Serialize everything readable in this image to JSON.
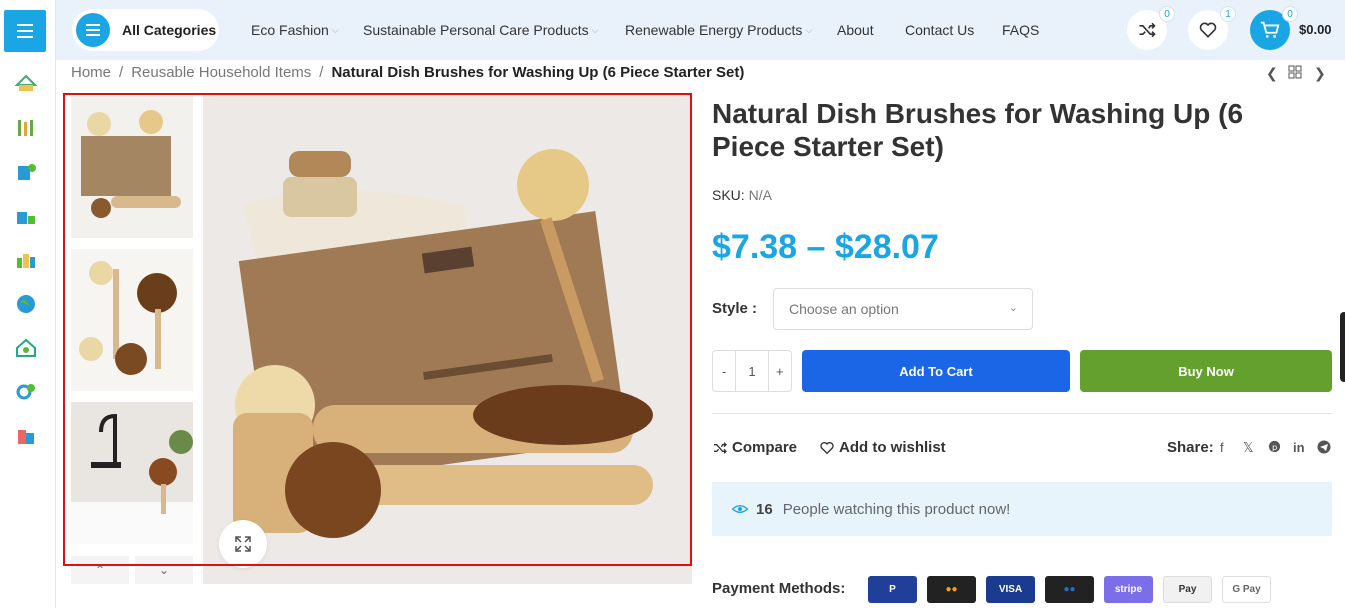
{
  "header": {
    "all_categories": "All Categories",
    "nav": [
      {
        "label": "Eco Fashion",
        "caret": true
      },
      {
        "label": "Sustainable Personal Care Products",
        "caret": true
      },
      {
        "label": "Renewable Energy Products",
        "caret": true
      },
      {
        "label": "About",
        "caret": false
      },
      {
        "label": "Contact Us",
        "caret": false
      },
      {
        "label": "FAQS",
        "caret": false
      }
    ],
    "compare_count": "0",
    "wishlist_count": "1",
    "cart_count": "0",
    "cart_total": "$0.00",
    "accent": "#1aa5e5"
  },
  "breadcrumb": {
    "home": "Home",
    "category": "Reusable Household Items",
    "current": "Natural Dish Brushes for Washing Up (6 Piece Starter Set)",
    "sep": "/"
  },
  "product": {
    "title": "Natural Dish Brushes for Washing Up (6 Piece Starter Set)",
    "sku_label": "SKU:",
    "sku_value": "N/A",
    "price": "$7.38 – $28.07",
    "style_label": "Style",
    "style_placeholder": "Choose an option",
    "qty_minus": "-",
    "qty_value": "1",
    "qty_plus": "+",
    "add_to_cart": "Add To Cart",
    "buy_now": "Buy Now",
    "compare": "Compare",
    "wishlist": "Add to wishlist",
    "share": "Share:",
    "watching_count": "16",
    "watching_text": "People watching this product now!",
    "payment_label": "Payment Methods:"
  },
  "payment_methods": [
    {
      "name": "PayPal",
      "label": "P",
      "color": "#1f3f99",
      "text": "#fff"
    },
    {
      "name": "Mastercard",
      "label": "●●",
      "color": "#222",
      "text": "#f79e1b"
    },
    {
      "name": "Visa",
      "label": "VISA",
      "color": "#1a3b8f",
      "text": "#fff"
    },
    {
      "name": "Maestro",
      "label": "●●",
      "color": "#222",
      "text": "#1b6fd6"
    },
    {
      "name": "Stripe",
      "label": "stripe",
      "color": "#7b6ee8",
      "text": "#fff"
    },
    {
      "name": "Apple Pay",
      "label": "Pay",
      "color": "#f1f1f1",
      "text": "#333"
    },
    {
      "name": "Google Pay",
      "label": "G Pay",
      "color": "#fff",
      "text": "#666"
    }
  ],
  "colors": {
    "add_to_cart": "#1a66e6",
    "buy_now": "#63a02e",
    "gallery_outline": "#dd1111"
  }
}
